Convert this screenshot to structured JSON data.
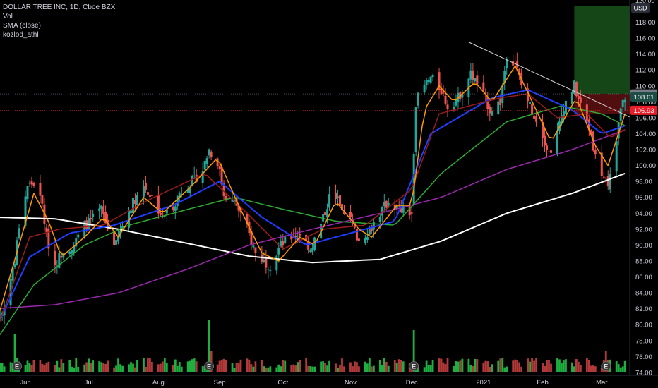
{
  "legend": {
    "title": "DOLLAR TREE INC, 1D, Cboe BZX",
    "line2": "Vol",
    "line3": "SMA (close)",
    "line4": "kozlod_athl"
  },
  "price_axis": {
    "currency": "USD",
    "top_partial_label": "120.00",
    "tags": [
      {
        "value": 109.0,
        "label": "109.00",
        "bg": "#787b86"
      },
      {
        "value": 108.61,
        "label": "108.61",
        "bg": "#1e4d45"
      },
      {
        "value": 106.93,
        "label": "106.93",
        "bg": "#e91e2a"
      }
    ]
  },
  "colors": {
    "background": "#000000",
    "up": "#26a69a",
    "down": "#ef5350",
    "vol_up": "#1fae3f",
    "vol_down": "#b33a3a",
    "sma_white": "#ffffff",
    "sma_purple": "#9c27b0",
    "sma_green": "#2eab32",
    "sma_blue": "#1e3dff",
    "sma_darkred": "#9b1c1c",
    "sma_orange": "#ff9800",
    "trendline": "#d8d8d8",
    "target_box": "#1b5e20",
    "stop_box": "#5a0f0f",
    "axis_text": "#d1d4dc"
  },
  "chart_data": {
    "type": "candlestick",
    "title": "DOLLAR TREE INC, 1D, Cboe BZX",
    "y_axis": {
      "range": [
        73,
        120
      ],
      "ticks": [
        74,
        76,
        78,
        80,
        82,
        84,
        86,
        88,
        90,
        92,
        94,
        96,
        98,
        100,
        102,
        104,
        106,
        108,
        110,
        112,
        114,
        116,
        118
      ]
    },
    "x_axis": {
      "labels": [
        "Jun",
        "Jul",
        "Aug",
        "Sep",
        "Oct",
        "Nov",
        "Dec",
        "2021",
        "Feb",
        "Mar"
      ],
      "label_dates": [
        "2020-06-01",
        "2020-07-01",
        "2020-08-03",
        "2020-09-01",
        "2020-10-01",
        "2020-11-02",
        "2020-12-01",
        "2021-01-04",
        "2021-02-01",
        "2021-03-01"
      ]
    },
    "price_anchors": [
      [
        "2020-05-18",
        80.0
      ],
      [
        "2020-05-22",
        82.5
      ],
      [
        "2020-05-27",
        88.0
      ],
      [
        "2020-05-29",
        92.5
      ],
      [
        "2020-06-02",
        97.5
      ],
      [
        "2020-06-05",
        97.8
      ],
      [
        "2020-06-09",
        95.0
      ],
      [
        "2020-06-11",
        91.0
      ],
      [
        "2020-06-15",
        87.5
      ],
      [
        "2020-06-19",
        89.5
      ],
      [
        "2020-06-24",
        90.0
      ],
      [
        "2020-06-29",
        92.5
      ],
      [
        "2020-07-02",
        93.0
      ],
      [
        "2020-07-07",
        94.5
      ],
      [
        "2020-07-10",
        92.0
      ],
      [
        "2020-07-14",
        90.0
      ],
      [
        "2020-07-17",
        92.5
      ],
      [
        "2020-07-21",
        95.0
      ],
      [
        "2020-07-27",
        97.5
      ],
      [
        "2020-07-31",
        96.0
      ],
      [
        "2020-08-05",
        93.5
      ],
      [
        "2020-08-10",
        95.0
      ],
      [
        "2020-08-14",
        97.0
      ],
      [
        "2020-08-19",
        98.0
      ],
      [
        "2020-08-24",
        99.5
      ],
      [
        "2020-08-27",
        102.0
      ],
      [
        "2020-08-31",
        100.5
      ],
      [
        "2020-09-03",
        96.5
      ],
      [
        "2020-09-09",
        95.0
      ],
      [
        "2020-09-14",
        92.0
      ],
      [
        "2020-09-18",
        89.0
      ],
      [
        "2020-09-22",
        88.0
      ],
      [
        "2020-09-25",
        87.5
      ],
      [
        "2020-09-30",
        90.0
      ],
      [
        "2020-10-05",
        91.0
      ],
      [
        "2020-10-09",
        91.5
      ],
      [
        "2020-10-14",
        89.5
      ],
      [
        "2020-10-19",
        92.5
      ],
      [
        "2020-10-23",
        96.0
      ],
      [
        "2020-10-28",
        95.5
      ],
      [
        "2020-11-02",
        93.0
      ],
      [
        "2020-11-06",
        90.5
      ],
      [
        "2020-11-11",
        92.0
      ],
      [
        "2020-11-16",
        94.0
      ],
      [
        "2020-11-20",
        95.5
      ],
      [
        "2020-11-25",
        94.5
      ],
      [
        "2020-12-01",
        94.0
      ],
      [
        "2020-12-03",
        108.0
      ],
      [
        "2020-12-07",
        110.0
      ],
      [
        "2020-12-10",
        111.0
      ],
      [
        "2020-12-15",
        109.5
      ],
      [
        "2020-12-18",
        107.5
      ],
      [
        "2020-12-23",
        108.5
      ],
      [
        "2020-12-29",
        111.5
      ],
      [
        "2021-01-04",
        109.0
      ],
      [
        "2021-01-07",
        107.0
      ],
      [
        "2021-01-12",
        108.0
      ],
      [
        "2021-01-15",
        114.0
      ],
      [
        "2021-01-19",
        113.0
      ],
      [
        "2021-01-22",
        110.0
      ],
      [
        "2021-01-27",
        107.0
      ],
      [
        "2021-02-01",
        104.0
      ],
      [
        "2021-02-04",
        101.5
      ],
      [
        "2021-02-08",
        104.0
      ],
      [
        "2021-02-11",
        107.5
      ],
      [
        "2021-02-16",
        110.0
      ],
      [
        "2021-02-19",
        107.5
      ],
      [
        "2021-02-24",
        104.0
      ],
      [
        "2021-02-26",
        101.0
      ],
      [
        "2021-03-02",
        98.5
      ],
      [
        "2021-03-04",
        97.0
      ],
      [
        "2021-03-08",
        103.0
      ],
      [
        "2021-03-10",
        107.0
      ],
      [
        "2021-03-12",
        108.61
      ]
    ],
    "sma_anchors": {
      "white": [
        [
          "2020-05-18",
          93.5
        ],
        [
          "2020-06-15",
          93.3
        ],
        [
          "2020-07-15",
          92.0
        ],
        [
          "2020-08-17",
          90.2
        ],
        [
          "2020-09-15",
          88.6
        ],
        [
          "2020-10-15",
          87.8
        ],
        [
          "2020-11-16",
          88.2
        ],
        [
          "2020-12-15",
          90.5
        ],
        [
          "2021-01-15",
          94.0
        ],
        [
          "2021-02-15",
          96.5
        ],
        [
          "2021-03-12",
          99.0
        ]
      ],
      "purple": [
        [
          "2020-05-18",
          82.0
        ],
        [
          "2020-06-15",
          82.5
        ],
        [
          "2020-07-15",
          84.0
        ],
        [
          "2020-08-17",
          87.0
        ],
        [
          "2020-09-15",
          90.0
        ],
        [
          "2020-10-15",
          92.0
        ],
        [
          "2020-11-16",
          94.0
        ],
        [
          "2020-12-15",
          96.0
        ],
        [
          "2021-01-15",
          99.5
        ],
        [
          "2021-02-15",
          102.0
        ],
        [
          "2021-03-12",
          104.5
        ]
      ],
      "green": [
        [
          "2020-05-18",
          78.0
        ],
        [
          "2020-06-05",
          85.0
        ],
        [
          "2020-06-29",
          90.0
        ],
        [
          "2020-07-20",
          92.5
        ],
        [
          "2020-08-17",
          94.5
        ],
        [
          "2020-09-08",
          96.0
        ],
        [
          "2020-10-01",
          94.5
        ],
        [
          "2020-10-26",
          93.0
        ],
        [
          "2020-11-23",
          92.5
        ],
        [
          "2020-12-15",
          99.0
        ],
        [
          "2021-01-15",
          105.5
        ],
        [
          "2021-02-10",
          107.5
        ],
        [
          "2021-03-01",
          106.5
        ],
        [
          "2021-03-12",
          105.0
        ]
      ],
      "blue": [
        [
          "2020-05-18",
          79.5
        ],
        [
          "2020-06-03",
          88.5
        ],
        [
          "2020-06-22",
          91.5
        ],
        [
          "2020-07-13",
          92.5
        ],
        [
          "2020-08-10",
          95.0
        ],
        [
          "2020-09-01",
          98.0
        ],
        [
          "2020-09-21",
          93.5
        ],
        [
          "2020-10-12",
          90.0
        ],
        [
          "2020-11-02",
          91.5
        ],
        [
          "2020-11-23",
          93.0
        ],
        [
          "2020-12-10",
          104.0
        ],
        [
          "2021-01-08",
          108.5
        ],
        [
          "2021-01-25",
          109.5
        ],
        [
          "2021-02-15",
          107.0
        ],
        [
          "2021-03-01",
          104.0
        ],
        [
          "2021-03-12",
          105.0
        ]
      ],
      "darkred": [
        [
          "2020-05-18",
          79.0
        ],
        [
          "2020-06-03",
          91.0
        ],
        [
          "2020-06-17",
          92.0
        ],
        [
          "2020-07-08",
          92.5
        ],
        [
          "2020-07-28",
          95.5
        ],
        [
          "2020-08-25",
          99.0
        ],
        [
          "2020-09-14",
          94.0
        ],
        [
          "2020-10-01",
          89.5
        ],
        [
          "2020-10-20",
          92.0
        ],
        [
          "2020-11-09",
          92.5
        ],
        [
          "2020-12-01",
          97.0
        ],
        [
          "2020-12-14",
          106.5
        ],
        [
          "2021-01-12",
          108.5
        ],
        [
          "2021-01-25",
          109.0
        ],
        [
          "2021-02-08",
          106.0
        ],
        [
          "2021-02-22",
          106.5
        ],
        [
          "2021-03-05",
          103.5
        ],
        [
          "2021-03-12",
          104.5
        ]
      ],
      "orange": [
        [
          "2020-05-18",
          80.0
        ],
        [
          "2020-05-29",
          90.0
        ],
        [
          "2020-06-05",
          96.5
        ],
        [
          "2020-06-12",
          93.0
        ],
        [
          "2020-06-18",
          88.5
        ],
        [
          "2020-06-29",
          91.0
        ],
        [
          "2020-07-08",
          93.5
        ],
        [
          "2020-07-15",
          91.0
        ],
        [
          "2020-07-27",
          96.0
        ],
        [
          "2020-08-05",
          94.0
        ],
        [
          "2020-08-19",
          97.5
        ],
        [
          "2020-08-31",
          101.0
        ],
        [
          "2020-09-10",
          95.0
        ],
        [
          "2020-09-21",
          89.0
        ],
        [
          "2020-09-29",
          88.0
        ],
        [
          "2020-10-09",
          91.0
        ],
        [
          "2020-10-16",
          90.0
        ],
        [
          "2020-10-26",
          95.5
        ],
        [
          "2020-11-06",
          92.0
        ],
        [
          "2020-11-12",
          91.0
        ],
        [
          "2020-11-24",
          95.0
        ],
        [
          "2020-12-01",
          95.0
        ],
        [
          "2020-12-07",
          107.0
        ],
        [
          "2020-12-14",
          110.0
        ],
        [
          "2020-12-21",
          108.0
        ],
        [
          "2020-12-31",
          110.5
        ],
        [
          "2021-01-08",
          108.0
        ],
        [
          "2021-01-19",
          112.5
        ],
        [
          "2021-01-28",
          107.5
        ],
        [
          "2021-02-05",
          103.0
        ],
        [
          "2021-02-17",
          108.5
        ],
        [
          "2021-02-26",
          102.5
        ],
        [
          "2021-03-04",
          100.0
        ],
        [
          "2021-03-12",
          106.5
        ]
      ]
    },
    "trendline": {
      "from": [
        "2020-12-28",
        115.5
      ],
      "to": [
        "2021-03-15",
        106.0
      ]
    },
    "level_lines": [
      109.0,
      108.61,
      106.93
    ],
    "target_zone": {
      "from_date": "2021-02-16",
      "to_date": "2021-03-19",
      "top": 120.0,
      "bottom": 109.0
    },
    "stop_zone": {
      "from_date": "2021-02-16",
      "to_date": "2021-03-19",
      "top": 109.0,
      "bottom": 106.5
    },
    "earnings_dates": [
      "2020-05-28",
      "2020-08-27",
      "2020-12-02",
      "2021-03-03"
    ],
    "volume_spikes": [
      [
        "2020-05-27",
        55
      ],
      [
        "2020-08-27",
        75
      ],
      [
        "2020-08-28",
        30
      ],
      [
        "2020-12-02",
        60
      ],
      [
        "2021-03-03",
        30
      ]
    ],
    "earnings_marker_label": "E"
  }
}
